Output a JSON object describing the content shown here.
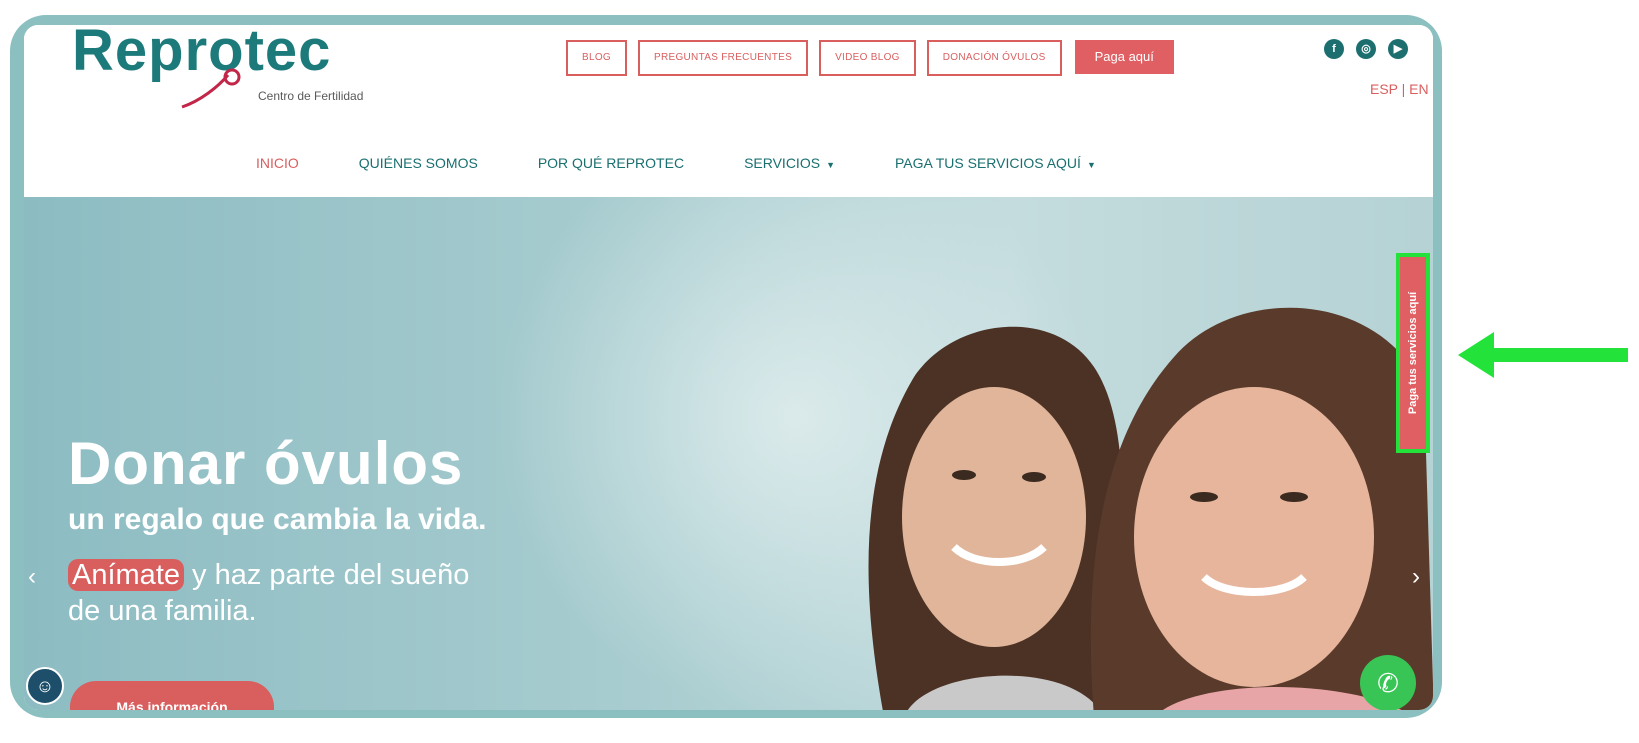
{
  "logo": {
    "name": "Reprotec",
    "tagline": "Centro de Fertilidad"
  },
  "top_links": [
    "BLOG",
    "PREGUNTAS FRECUENTES",
    "VIDEO BLOG",
    "DONACIÓN ÓVULOS"
  ],
  "pay_button": "Paga aquí",
  "socials": [
    {
      "icon": "facebook-icon",
      "glyph": "f"
    },
    {
      "icon": "instagram-icon",
      "glyph": "◎"
    },
    {
      "icon": "youtube-icon",
      "glyph": "▶"
    }
  ],
  "language": "ESP | EN",
  "nav": {
    "inicio": "INICIO",
    "quienes": "QUIÉNES SOMOS",
    "porque": "POR QUÉ REPROTEC",
    "servicios": "SERVICIOS",
    "paga": "PAGA TUS SERVICIOS AQUÍ"
  },
  "hero": {
    "title": "Donar óvulos",
    "subtitle": "un regalo que cambia la vida.",
    "line1_highlight": "Anímate",
    "line1_rest": " y haz parte del sueño",
    "line2": "de una familia.",
    "button": "Más información"
  },
  "side_tab": "Paga tus servicios aquí",
  "colors": {
    "brand_teal": "#1d7a7a",
    "accent_red": "#d95f5f",
    "highlight_green": "#23e23a",
    "frame": "#8bbfc0"
  }
}
